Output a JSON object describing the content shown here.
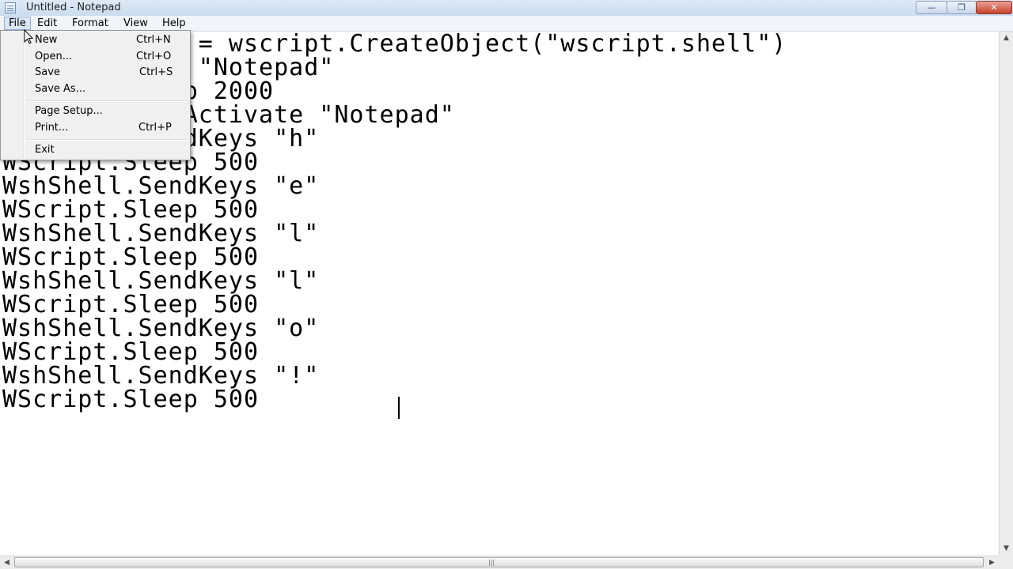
{
  "window": {
    "title": "Untitled - Notepad",
    "controls": {
      "minimize": "—",
      "maximize": "❐",
      "close": "✕"
    }
  },
  "menubar": {
    "items": [
      "File",
      "Edit",
      "Format",
      "View",
      "Help"
    ],
    "active": "File"
  },
  "file_menu": {
    "items": [
      {
        "label": "New",
        "shortcut": "Ctrl+N"
      },
      {
        "label": "Open...",
        "shortcut": "Ctrl+O"
      },
      {
        "label": "Save",
        "shortcut": "Ctrl+S"
      },
      {
        "label": "Save As...",
        "shortcut": ""
      },
      {
        "label": "Page Setup...",
        "shortcut": ""
      },
      {
        "label": "Print...",
        "shortcut": "Ctrl+P"
      },
      {
        "label": "Exit",
        "shortcut": ""
      }
    ]
  },
  "editor": {
    "lines": [
      "Set WshShell = wscript.CreateObject(\"wscript.shell\")",
      "WshShell.run \"Notepad\"",
      "WScript.Sleep 2000",
      "WshShell.AppActivate \"Notepad\"",
      "WshShell.SendKeys \"h\"",
      "WScript.Sleep 500",
      "WshShell.SendKeys \"e\"",
      "WScript.Sleep 500",
      "WshShell.SendKeys \"l\"",
      "WScript.Sleep 500",
      "WshShell.SendKeys \"l\"",
      "WScript.Sleep 500",
      "WshShell.SendKeys \"o\"",
      "WScript.Sleep 500",
      "WshShell.SendKeys \"!\"",
      "WScript.Sleep 500"
    ]
  },
  "scrollbars": {
    "up": "▲",
    "down": "▼",
    "left": "◀",
    "right": "▶",
    "grip": "|||"
  },
  "colors": {
    "titlebar": "#cbdcef",
    "menu_highlight": "#dbe7f7",
    "close_button": "#c7402a"
  }
}
